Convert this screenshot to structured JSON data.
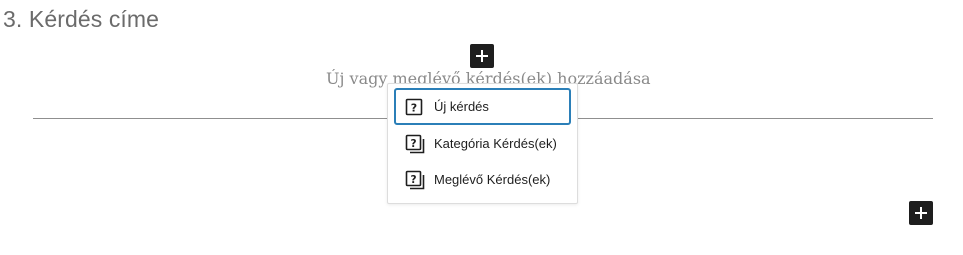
{
  "question": {
    "title": "3. Kérdés címe"
  },
  "inserter": {
    "hint": "Új vagy meglévő kérdés(ek) hozzáadása"
  },
  "menu": {
    "items": [
      {
        "label": "Új kérdés",
        "icon": "question-icon",
        "focused": true
      },
      {
        "label": "Kategória Kérdés(ek)",
        "icon": "question-stack-icon",
        "focused": false
      },
      {
        "label": "Meglévő Kérdés(ek)",
        "icon": "question-stack-icon",
        "focused": false
      }
    ]
  },
  "colors": {
    "focus_ring": "#2b7fb8",
    "button_bg": "#1e1e1e"
  }
}
